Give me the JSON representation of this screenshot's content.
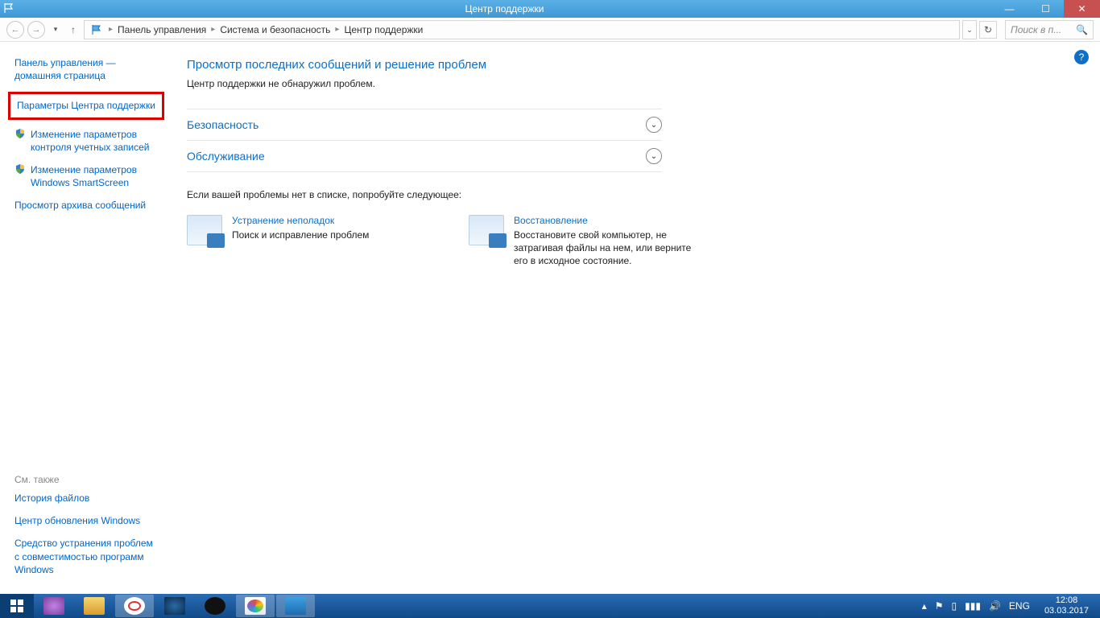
{
  "titlebar": {
    "title": "Центр поддержки"
  },
  "breadcrumbs": {
    "items": [
      "Панель управления",
      "Система и безопасность",
      "Центр поддержки"
    ]
  },
  "search": {
    "placeholder": "Поиск в п..."
  },
  "sidebar": {
    "home": "Панель управления — домашняя страница",
    "highlighted": "Параметры Центра поддержки",
    "items": [
      "Изменение параметров контроля учетных записей",
      "Изменение параметров Windows SmartScreen",
      "Просмотр архива сообщений"
    ],
    "seealso_title": "См. также",
    "seealso": [
      "История файлов",
      "Центр обновления Windows",
      "Средство устранения проблем с совместимостью программ Windows"
    ]
  },
  "content": {
    "heading": "Просмотр последних сообщений и решение проблем",
    "sub": "Центр поддержки не обнаружил проблем.",
    "expanders": [
      {
        "title": "Безопасность"
      },
      {
        "title": "Обслуживание"
      }
    ],
    "notlisted": "Если вашей проблемы нет в списке, попробуйте следующее:",
    "cards": [
      {
        "title": "Устранение неполадок",
        "desc": "Поиск и исправление проблем"
      },
      {
        "title": "Восстановление",
        "desc": "Восстановите свой компьютер, не затрагивая файлы на нем, или верните его в исходное состояние."
      }
    ]
  },
  "tray": {
    "lang": "ENG",
    "time": "12:08",
    "date": "03.03.2017"
  }
}
